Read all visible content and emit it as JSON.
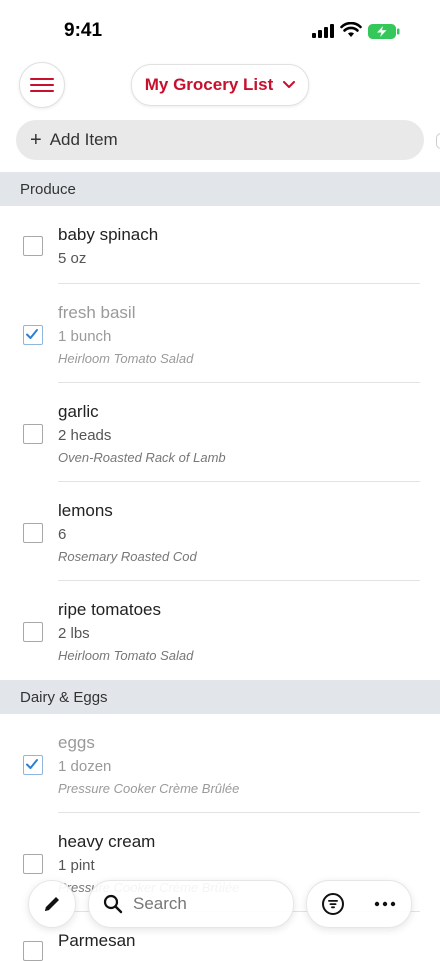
{
  "status_bar": {
    "time": "9:41"
  },
  "header": {
    "list_title": "My Grocery List"
  },
  "add_item": {
    "label": "Add Item"
  },
  "sections": [
    {
      "title": "Produce"
    },
    {
      "title": "Dairy & Eggs"
    }
  ],
  "items": [
    {
      "name": "baby spinach",
      "qty": "5 oz",
      "recipe": "",
      "checked": false
    },
    {
      "name": "fresh basil",
      "qty": "1 bunch",
      "recipe": "Heirloom Tomato Salad",
      "checked": true
    },
    {
      "name": "garlic",
      "qty": "2 heads",
      "recipe": "Oven-Roasted Rack of Lamb",
      "checked": false
    },
    {
      "name": "lemons",
      "qty": "6",
      "recipe": "Rosemary Roasted Cod",
      "checked": false
    },
    {
      "name": "ripe tomatoes",
      "qty": "2 lbs",
      "recipe": "Heirloom Tomato Salad",
      "checked": false
    },
    {
      "name": "eggs",
      "qty": "1 dozen",
      "recipe": "Pressure Cooker Crème Brûlée",
      "checked": true
    },
    {
      "name": "heavy cream",
      "qty": "1 pint",
      "recipe": "Pressure Cooker Crème Brûlée",
      "checked": false
    },
    {
      "name": "Parmesan",
      "qty": "",
      "recipe": "",
      "checked": false
    }
  ],
  "bottom_bar": {
    "search_placeholder": "Search"
  },
  "colors": {
    "accent": "#c8102e",
    "check": "#2f7fd1",
    "battery": "#34c759"
  },
  "icons": [
    "hamburger-icon",
    "chevron-down-icon",
    "plus-icon",
    "checkmark-icon",
    "pencil-icon",
    "search-icon",
    "filter-icon",
    "more-icon"
  ]
}
